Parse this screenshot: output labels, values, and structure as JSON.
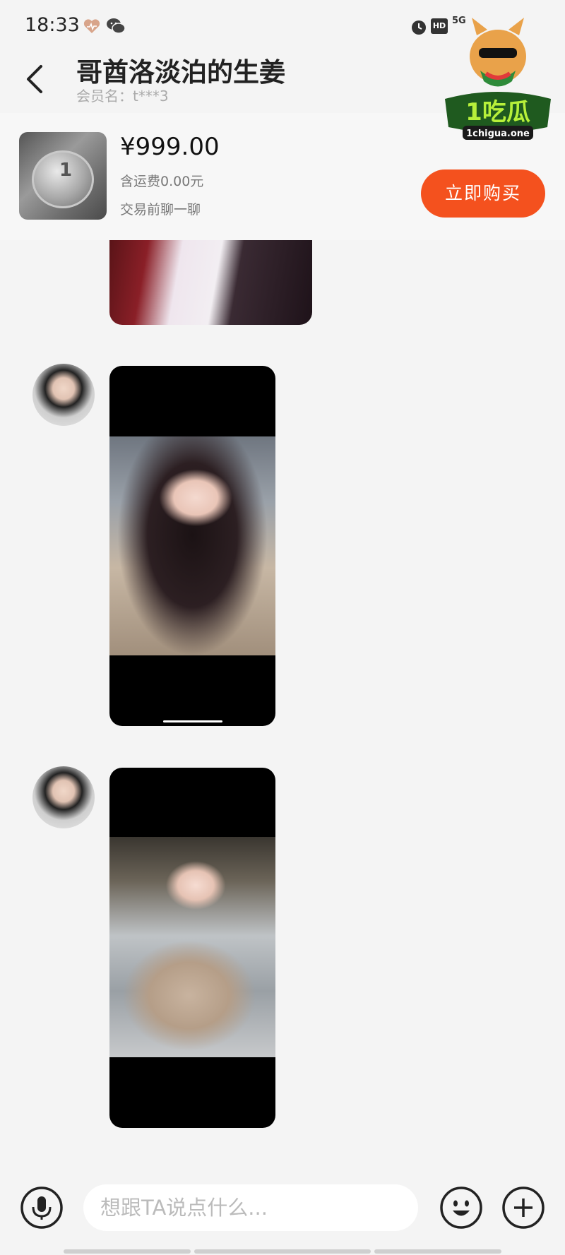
{
  "status_bar": {
    "time": "18:33",
    "network": "5G",
    "hd_badge": "HD"
  },
  "header": {
    "title": "哥酋洛淡泊的生姜",
    "member_label": "会员名：",
    "member_name": "t***3"
  },
  "product": {
    "price": "¥999.00",
    "shipping": "含运费0.00元",
    "tip": "交易前聊一聊",
    "buy_label": "立即购买"
  },
  "watermark": {
    "name": "1吃瓜",
    "site": "1chigua.one"
  },
  "input_bar": {
    "placeholder": "想跟TA说点什么..."
  },
  "colors": {
    "accent": "#f4511e",
    "background": "#f4f4f4"
  },
  "icons": [
    "back-arrow-icon",
    "mic-icon",
    "emoji-icon",
    "plus-icon",
    "alarm-icon",
    "wechat-icon",
    "heart-icon"
  ]
}
